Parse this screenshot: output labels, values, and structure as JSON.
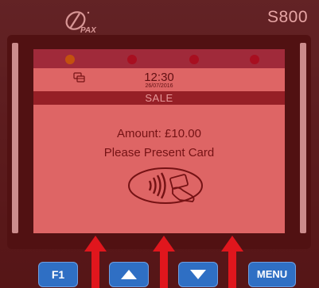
{
  "device": {
    "model": "S800",
    "brand": "PAX"
  },
  "screen": {
    "time": "12:30",
    "date": "26/07/2016",
    "transaction_type": "SALE",
    "amount_text": "Amount: £10.00",
    "prompt": "Please Present Card"
  },
  "keys": {
    "f1": "F1",
    "menu": "MENU"
  },
  "colors": {
    "tint": "#be0f0f",
    "screen_bg": "#f29a9a",
    "key_blue": "#2f6fc4",
    "arrow_red": "#e0161d"
  }
}
